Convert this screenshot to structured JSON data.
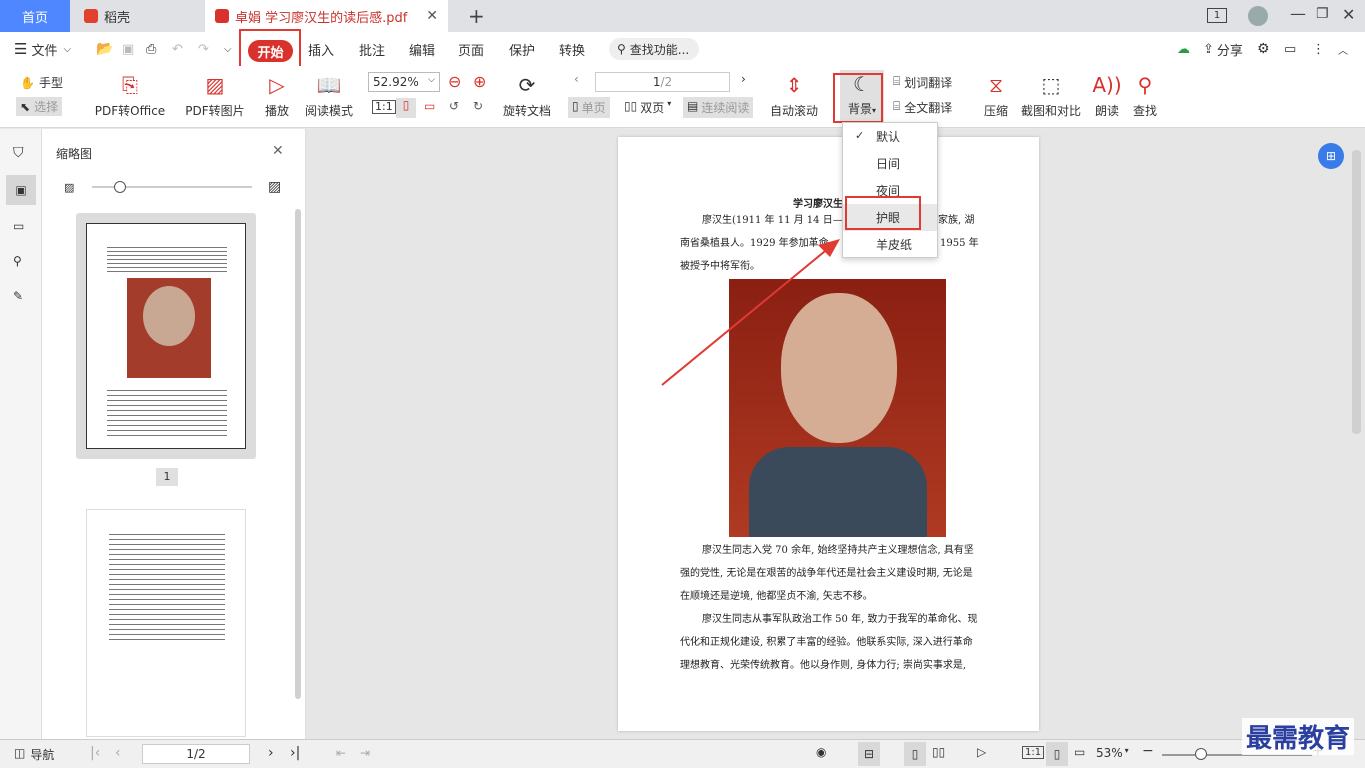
{
  "tabs": {
    "home": "首页",
    "daoke": "稻壳",
    "doc": "卓娟 学习廖汉生的读后感.pdf"
  },
  "menu": {
    "file": "文件",
    "start": "开始",
    "insert": "插入",
    "annotate": "批注",
    "edit": "编辑",
    "page": "页面",
    "protect": "保护",
    "convert": "转换",
    "search_placeholder": "查找功能...",
    "share": "分享"
  },
  "toolbar": {
    "hand": "手型",
    "select": "选择",
    "pdf_to_office": "PDF转Office",
    "pdf_to_image": "PDF转图片",
    "play": "播放",
    "read_mode": "阅读模式",
    "zoom": "52.92%",
    "rotate": "旋转文档",
    "page_current": "1",
    "page_total": "/2",
    "single": "单页",
    "double": "双页",
    "continuous": "连续阅读",
    "auto_scroll": "自动滚动",
    "background": "背景",
    "word_translate": "划词翻译",
    "full_translate": "全文翻译",
    "compress": "压缩",
    "screenshot_compare": "截图和对比",
    "read_aloud": "朗读",
    "find": "查找"
  },
  "dropdown": {
    "items": [
      "默认",
      "日间",
      "夜间",
      "护眼",
      "羊皮纸"
    ],
    "checked": "默认",
    "highlighted": "护眼"
  },
  "thumbnails": {
    "title": "缩略图",
    "page1_label": "1"
  },
  "document": {
    "title": "学习廖汉生",
    "p1_l1a": "廖汉生(1911 年 11 月 14 日—200",
    "p1_l1b": "家族, 湖",
    "p1_l2a": "南省桑植县人。1929 年参加革命",
    "p1_l2b": "1955 年",
    "p1_l3": "被授予中将军衔。",
    "p2_l1": "廖汉生同志入党 70 余年, 始终坚持共产主义理想信念, 具有坚",
    "p2_l2": "强的党性, 无论是在艰苦的战争年代还是社会主义建设时期, 无论是",
    "p2_l3": "在顺境还是逆境, 他都坚贞不渝, 矢志不移。",
    "p3_l1": "廖汉生同志从事军队政治工作 50 年, 致力于我军的革命化、现",
    "p3_l2": "代化和正规化建设, 积累了丰富的经验。他联系实际, 深入进行革命",
    "p3_l3": "理想教育、光荣传统教育。他以身作则, 身体力行; 崇尚实事求是,"
  },
  "status": {
    "nav": "导航",
    "page": "1/2",
    "zoom": "53%"
  },
  "watermark": "最需教育"
}
